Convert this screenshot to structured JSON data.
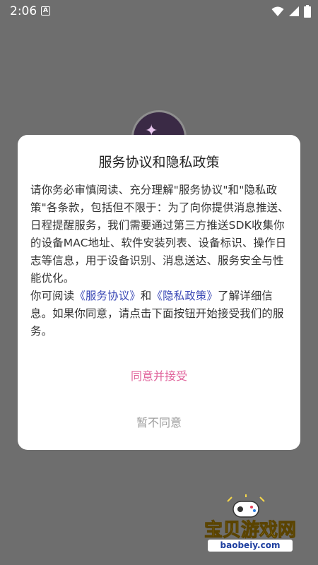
{
  "status_bar": {
    "time": "2:06",
    "notification_badge": "A",
    "icons": [
      "wifi-icon",
      "signal-icon",
      "battery-icon"
    ]
  },
  "dialog": {
    "title": "服务协议和隐私政策",
    "paragraph1": "请你务必审慎阅读、充分理解\"服务协议\"和\"隐私政策\"各条款，包括但不限于：为了向你提供消息推送、日程提醒服务，我们需要通过第三方推送SDK收集你的设备MAC地址、软件安装列表、设备标识、操作日志等信息，用于设备识别、消息送达、服务安全与性能优化。",
    "p2_prefix": "你可阅读",
    "service_link": "《服务协议》",
    "p2_and": "和",
    "privacy_link": "《隐私政策》",
    "p2_suffix": "了解详细信息。如果你同意，请点击下面按钮开始接受我们的服务。",
    "agree_label": "同意并接受",
    "disagree_label": "暂不同意"
  },
  "watermark": {
    "title": "宝贝游戏网",
    "url": "baobeiy.com"
  },
  "colors": {
    "backdrop": "#6e6e6e",
    "link": "#3a48b5",
    "agree": "#e0619a",
    "disagree": "#9e9e9e"
  }
}
